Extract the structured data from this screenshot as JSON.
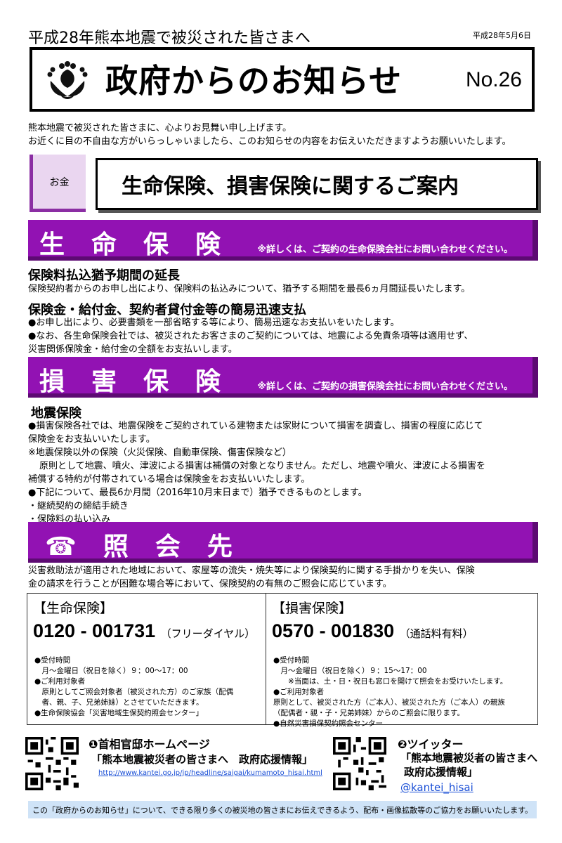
{
  "header": {
    "line": "平成28年熊本地震で被災された皆さまへ",
    "date": "平成28年5月6日",
    "title": "政府からのお知らせ",
    "number": "No.26"
  },
  "intro": [
    "熊本地震で被災された皆さまに、心よりお見舞い申し上げます。",
    "お近くに目の不自由な方がいらっしゃいましたら、このお知らせの内容をお伝えいただきますようお願いいたします。"
  ],
  "category_tag": "お金",
  "topic_title": "生命保険、損害保険に関するご案内",
  "life": {
    "banner": "生命保険",
    "note": "※詳しくは、ご契約の生命保険会社にお問い合わせください。",
    "h1": "保険料払込猶予期間の延長",
    "p1": "保険契約者からのお申し出により、保険料の払込みについて、猶予する期間を最長6ヵ月間延長いたします。",
    "h2": "保険金・給付金、契約者貸付金等の簡易迅速支払",
    "b1": "●お申し出により、必要書類を一部省略する等により、簡易迅速なお支払いをいたします。",
    "b2a": "●なお、各生命保険会社では、被災されたお客さまのご契約については、地震による免責条項等は適用せず、",
    "b2b": "災害関係保険金・給付金の全額をお支払いします。"
  },
  "damage": {
    "banner": "損害保険",
    "note": "※詳しくは、ご契約の損害保険会社にお問い合わせください。",
    "h1": "地震保険",
    "l1": "●損害保険各社では、地震保険をご契約されている建物または家財について損害を調査し、損害の程度に応じて",
    "l2": "保険金をお支払いいたします。",
    "l3": "※地震保険以外の保険（火災保険、自動車保険、傷害保険など）",
    "l4": "原則として地震、噴火、津波による損害は補償の対象となりません。ただし、地震や噴火、津波による損害を",
    "l5": "補償する特約が付帯されている場合は保険金をお支払いいたします。",
    "l6": "●下記について、最長6か月間（2016年10月末日まで）猶予できるものとします。",
    "l7": "・継続契約の締結手続き",
    "l8": "・保険料の払い込み"
  },
  "inquiry": {
    "banner": "照会先",
    "text1": "災害救助法が適用された地域において、家屋等の流失・焼失等により保険契約に関する手掛かりを失い、保険",
    "text2": "金の請求を行うことが困難な場合等において、保険契約の有無のご照会に応じています。",
    "life_box": {
      "head": "【生命保険】",
      "phone": "0120 - 001731",
      "phone_note": "（フリーダイヤル）",
      "lines": [
        "●受付時間",
        "　月～金曜日（祝日を除く）９：00～17：00",
        "●ご利用対象者",
        "　原則としてご照会対象者（被災された方）のご家族（配偶",
        "　者、親、子、兄弟姉妹）とさせていただきます。",
        "●生命保険協会「災害地域生保契約照会センター」"
      ]
    },
    "damage_box": {
      "head": "【損害保険】",
      "phone": "0570 - 001830",
      "phone_note": "（通話料有料）",
      "lines": [
        "●受付時間",
        "　月～金曜日（祝日を除く）９：15～17：00",
        "　　※当面は、土・日・祝日も窓口を開けて照会をお受けいたします。",
        "●ご利用対象者",
        "原則として、被災された方（ご本人）、被災された方（ご本人）の親族",
        "（配偶者・親・子・兄弟姉妹）からのご照会に限ります。",
        "●自然災害損保契約照会センター"
      ]
    }
  },
  "links": {
    "hp_label": "❶首相官邸ホームページ",
    "hp_name": "「熊本地震被災者の皆さまへ　政府応援情報」",
    "hp_url": "http://www.kantei.go.jp/jp/headline/saigai/kumamoto_hisai.html",
    "tw_label": "❷ツイッター",
    "tw_name1": "「熊本地震被災者の皆さまへ",
    "tw_name2": "政府応援情報」",
    "tw_handle": "@kantei_hisai"
  },
  "footer": "この「政府からのお知らせ」について、できる限り多くの被災地の皆さまにお伝えできるよう、配布・画像拡散等のご協力をお願いいたします。"
}
